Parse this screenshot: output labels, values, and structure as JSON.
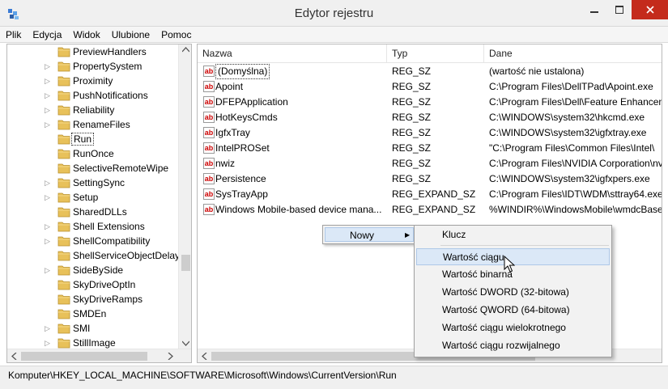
{
  "window": {
    "title": "Edytor rejestru"
  },
  "menu": [
    "Plik",
    "Edycja",
    "Widok",
    "Ulubione",
    "Pomoc"
  ],
  "tree": {
    "items": [
      {
        "label": "PreviewHandlers",
        "expandable": false
      },
      {
        "label": "PropertySystem",
        "expandable": true
      },
      {
        "label": "Proximity",
        "expandable": true
      },
      {
        "label": "PushNotifications",
        "expandable": true
      },
      {
        "label": "Reliability",
        "expandable": true
      },
      {
        "label": "RenameFiles",
        "expandable": true
      },
      {
        "label": "Run",
        "expandable": false,
        "selected": true
      },
      {
        "label": "RunOnce",
        "expandable": false
      },
      {
        "label": "SelectiveRemoteWipe",
        "expandable": false
      },
      {
        "label": "SettingSync",
        "expandable": true
      },
      {
        "label": "Setup",
        "expandable": true
      },
      {
        "label": "SharedDLLs",
        "expandable": false
      },
      {
        "label": "Shell Extensions",
        "expandable": true
      },
      {
        "label": "ShellCompatibility",
        "expandable": true
      },
      {
        "label": "ShellServiceObjectDelayL",
        "expandable": false
      },
      {
        "label": "SideBySide",
        "expandable": true
      },
      {
        "label": "SkyDriveOptIn",
        "expandable": false
      },
      {
        "label": "SkyDriveRamps",
        "expandable": false
      },
      {
        "label": "SMDEn",
        "expandable": false
      },
      {
        "label": "SMI",
        "expandable": true
      },
      {
        "label": "StillImage",
        "expandable": true
      }
    ]
  },
  "list": {
    "columns": {
      "name": "Nazwa",
      "type": "Typ",
      "data": "Dane"
    },
    "rows": [
      {
        "name": "(Domyślna)",
        "type": "REG_SZ",
        "data": "(wartość nie ustalona)"
      },
      {
        "name": "Apoint",
        "type": "REG_SZ",
        "data": "C:\\Program Files\\DellTPad\\Apoint.exe"
      },
      {
        "name": "DFEPApplication",
        "type": "REG_SZ",
        "data": "C:\\Program Files\\Dell\\Feature Enhancement"
      },
      {
        "name": "HotKeysCmds",
        "type": "REG_SZ",
        "data": "C:\\WINDOWS\\system32\\hkcmd.exe"
      },
      {
        "name": "IgfxTray",
        "type": "REG_SZ",
        "data": "C:\\WINDOWS\\system32\\igfxtray.exe"
      },
      {
        "name": "IntelPROSet",
        "type": "REG_SZ",
        "data": "\"C:\\Program Files\\Common Files\\Intel\\"
      },
      {
        "name": "nwiz",
        "type": "REG_SZ",
        "data": "C:\\Program Files\\NVIDIA Corporation\\nv"
      },
      {
        "name": "Persistence",
        "type": "REG_SZ",
        "data": "C:\\WINDOWS\\system32\\igfxpers.exe"
      },
      {
        "name": "SysTrayApp",
        "type": "REG_EXPAND_SZ",
        "data": "C:\\Program Files\\IDT\\WDM\\sttray64.exe"
      },
      {
        "name": "Windows Mobile-based device mana...",
        "type": "REG_EXPAND_SZ",
        "data": "%WINDIR%\\WindowsMobile\\wmdcBase"
      }
    ]
  },
  "context_menu": {
    "main_item": "Nowy",
    "submenu": [
      "Klucz",
      "Wartość ciągu",
      "Wartość binarna",
      "Wartość DWORD (32-bitowa)",
      "Wartość QWORD (64-bitowa)",
      "Wartość ciągu wielokrotnego",
      "Wartość ciągu rozwijalnego"
    ],
    "hovered_index": 1
  },
  "status": {
    "path": "Komputer\\HKEY_LOCAL_MACHINE\\SOFTWARE\\Microsoft\\Windows\\CurrentVersion\\Run"
  },
  "colors": {
    "close_button": "#c42b1c",
    "hover": "#dbe8f7",
    "folder": "#e8c15a"
  }
}
